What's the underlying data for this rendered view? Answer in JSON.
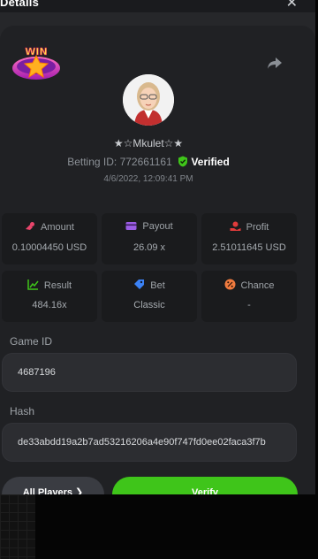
{
  "header": {
    "title": "Details",
    "close_icon": "close-icon"
  },
  "badge": {
    "logo_text": "WIN",
    "logo_icon": "win-star-badge"
  },
  "share_icon": "share-icon",
  "user": {
    "name": "★☆Mkulet☆★",
    "betting_id_label": "Betting ID: 772661161",
    "verified_label": "Verified",
    "date": "4/6/2022, 12:09:41 PM"
  },
  "stats": [
    {
      "label": "Amount",
      "value": "0.10004450 USD",
      "icon": "coins-icon",
      "color": "#e8456b"
    },
    {
      "label": "Payout",
      "value": "26.09 x",
      "icon": "card-icon",
      "color": "#9b5de5"
    },
    {
      "label": "Profit",
      "value": "2.51011645 USD",
      "icon": "hand-coin-icon",
      "color": "#e03b3b"
    },
    {
      "label": "Result",
      "value": "484.16x",
      "icon": "chart-icon",
      "color": "#3fc51a"
    },
    {
      "label": "Bet",
      "value": "Classic",
      "icon": "tag-icon",
      "color": "#3b82f6"
    },
    {
      "label": "Chance",
      "value": "-",
      "icon": "percent-icon",
      "color": "#f07b3f"
    }
  ],
  "game": {
    "id_label": "Game ID",
    "id_value": "4687196",
    "hash_label": "Hash",
    "hash_value": "de33abdd19a2b7ad53216206a4e90f747fd0ee02faca3f7b"
  },
  "buttons": {
    "players": "All Players ❯",
    "verify": "Verify"
  },
  "colors": {
    "accent_green": "#3fc51a",
    "modal_bg": "#26272a",
    "card_bg": "#202124"
  }
}
